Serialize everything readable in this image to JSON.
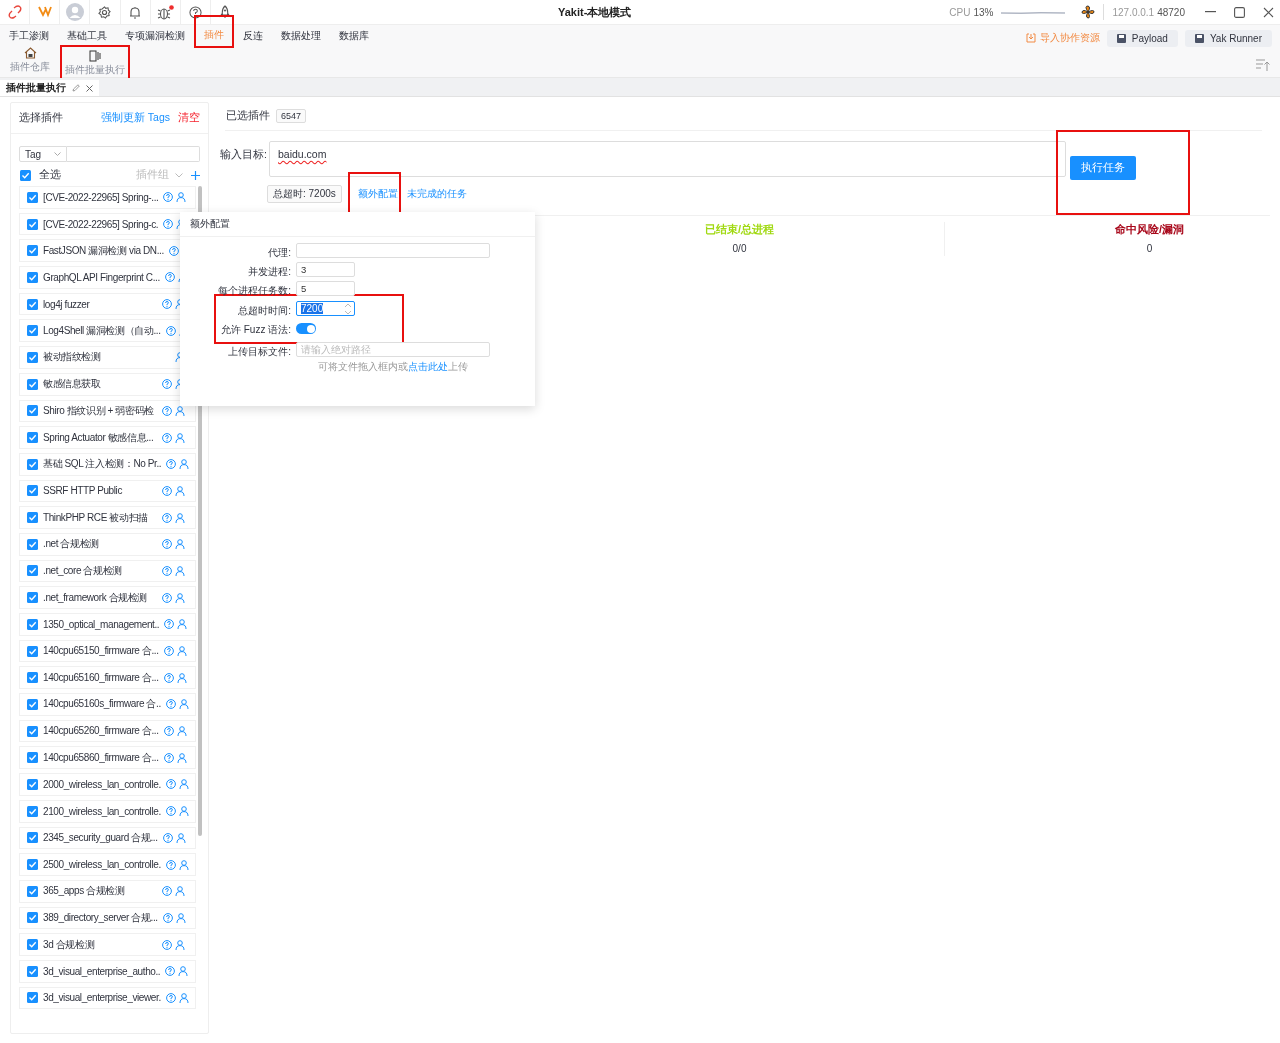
{
  "window": {
    "title": "Yakit-本地模式",
    "cpu_label": "CPU",
    "cpu_value": "13%",
    "host": "127.0.0.1",
    "port": "48720"
  },
  "menu": [
    {
      "label": "手工渗测",
      "selected": false,
      "highlighted": false
    },
    {
      "label": "基础工具",
      "selected": false,
      "highlighted": false
    },
    {
      "label": "专项漏洞检测",
      "selected": false,
      "highlighted": false
    },
    {
      "label": "插件",
      "selected": true,
      "highlighted": true
    },
    {
      "label": "反连",
      "selected": false,
      "highlighted": false
    },
    {
      "label": "数据处理",
      "selected": false,
      "highlighted": false
    },
    {
      "label": "数据库",
      "selected": false,
      "highlighted": false
    }
  ],
  "menu_actions": [
    {
      "kind": "link",
      "label": "导入协作资源"
    },
    {
      "kind": "button",
      "label": "Payload"
    },
    {
      "kind": "button",
      "label": "Yak Runner"
    }
  ],
  "submenu": [
    {
      "label": "插件仓库",
      "highlighted": false
    },
    {
      "label": "插件批量执行",
      "highlighted": true
    }
  ],
  "page_tab": {
    "label": "插件批量执行"
  },
  "plugin_panel": {
    "title": "选择插件",
    "update_tags": "强制更新 Tags",
    "clear": "清空",
    "tag_select": "Tag",
    "select_all": {
      "label": "全选",
      "checked": true
    },
    "group_select": "插件组",
    "plugins": [
      {
        "name": "[CVE-2022-22965] Spring-...",
        "checked": true,
        "has_help": true
      },
      {
        "name": "[CVE-2022-22965] Spring-c.",
        "checked": true,
        "has_help": true
      },
      {
        "name": "FastJSON 漏洞检测 via DN...",
        "checked": true,
        "has_help": true
      },
      {
        "name": "GraphQL API Fingerprint C...",
        "checked": true,
        "has_help": true
      },
      {
        "name": "log4j fuzzer",
        "checked": true,
        "has_help": true
      },
      {
        "name": "Log4Shell 漏洞检测（自动...",
        "checked": true,
        "has_help": true
      },
      {
        "name": "被动指纹检测",
        "checked": true,
        "has_help": false
      },
      {
        "name": "敏感信息获取",
        "checked": true,
        "has_help": true
      },
      {
        "name": "Shiro 指纹识别 + 弱密码检",
        "checked": true,
        "has_help": true
      },
      {
        "name": "Spring Actuator 敏感信息...",
        "checked": true,
        "has_help": true
      },
      {
        "name": "基础 SQL 注入检测：No Pr..",
        "checked": true,
        "has_help": true
      },
      {
        "name": "SSRF HTTP Public",
        "checked": true,
        "has_help": true
      },
      {
        "name": "ThinkPHP RCE 被动扫描",
        "checked": true,
        "has_help": true
      },
      {
        "name": ".net 合规检测",
        "checked": true,
        "has_help": true
      },
      {
        "name": ".net_core 合规检测",
        "checked": true,
        "has_help": true
      },
      {
        "name": ".net_framework 合规检测",
        "checked": true,
        "has_help": true
      },
      {
        "name": "1350_optical_management..",
        "checked": true,
        "has_help": true
      },
      {
        "name": "140cpu65150_firmware 合...",
        "checked": true,
        "has_help": true
      },
      {
        "name": "140cpu65160_firmware 合...",
        "checked": true,
        "has_help": true
      },
      {
        "name": "140cpu65160s_firmware 合..",
        "checked": true,
        "has_help": true
      },
      {
        "name": "140cpu65260_firmware 合...",
        "checked": true,
        "has_help": true
      },
      {
        "name": "140cpu65860_firmware 合...",
        "checked": true,
        "has_help": true
      },
      {
        "name": "2000_wireless_lan_controlle.",
        "checked": true,
        "has_help": true
      },
      {
        "name": "2100_wireless_lan_controlle.",
        "checked": true,
        "has_help": true
      },
      {
        "name": "2345_security_guard 合规...",
        "checked": true,
        "has_help": true
      },
      {
        "name": "2500_wireless_lan_controlle.",
        "checked": true,
        "has_help": true
      },
      {
        "name": "365_apps 合规检测",
        "checked": true,
        "has_help": true
      },
      {
        "name": "389_directory_server 合规...",
        "checked": true,
        "has_help": true
      },
      {
        "name": "3d 合规检测",
        "checked": true,
        "has_help": true
      },
      {
        "name": "3d_visual_enterprise_autho..",
        "checked": true,
        "has_help": true
      },
      {
        "name": "3d_visual_enterprise_viewer.",
        "checked": true,
        "has_help": true
      }
    ]
  },
  "exec_panel": {
    "selected_label": "已选插件",
    "selected_count": "6547",
    "target_label": "输入目标:",
    "target_value": "baidu.com",
    "run_button": {
      "label": "执行任务",
      "highlighted": true
    },
    "timeout_tag": "总超时: 7200s",
    "extra_link": {
      "label": "额外配置",
      "highlighted": true
    },
    "unfinished_link": "未完成的任务",
    "stats": [
      {
        "label": "已结束/总进程",
        "value": "0/0",
        "color": "#a0d911"
      },
      {
        "label": "命中风险/漏洞",
        "value": "0",
        "color": "#a8071a"
      }
    ]
  },
  "config_popover": {
    "title": "额外配置",
    "fields": [
      {
        "kind": "input",
        "label": "代理:",
        "highlighted": false
      },
      {
        "kind": "input",
        "label": "并发进程:",
        "value": "3",
        "highlighted": false
      },
      {
        "kind": "input",
        "label": "每个进程任务数:",
        "value": "5",
        "highlighted": false
      },
      {
        "kind": "number",
        "label": "总超时时间:",
        "value": "7200",
        "highlighted": true
      },
      {
        "kind": "switch",
        "label": "允许 Fuzz 语法:",
        "on": true,
        "highlighted": true
      },
      {
        "kind": "file",
        "label": "上传目标文件:",
        "placeholder": "请输入绝对路径",
        "hint_before": "可将文件拖入框内或",
        "hint_link": "点击此处",
        "hint_after": "上传",
        "highlighted": false
      }
    ]
  }
}
